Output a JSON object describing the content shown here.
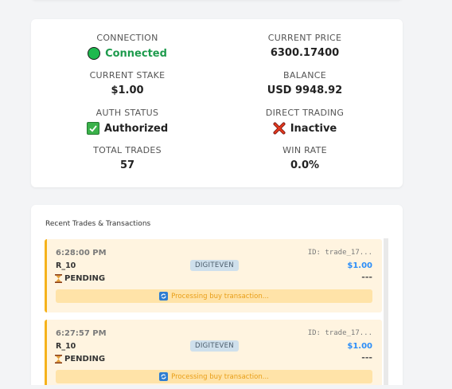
{
  "stats": {
    "connection": {
      "label": "CONNECTION",
      "value": "Connected",
      "icon": "green-circle-icon"
    },
    "current_price": {
      "label": "CURRENT PRICE",
      "value": "6300.17400"
    },
    "current_stake": {
      "label": "CURRENT STAKE",
      "value": "$1.00"
    },
    "balance": {
      "label": "BALANCE",
      "value": "USD 9948.92"
    },
    "auth_status": {
      "label": "AUTH STATUS",
      "value": "Authorized",
      "icon": "check-mark-icon"
    },
    "direct_trading": {
      "label": "DIRECT TRADING",
      "value": "Inactive",
      "icon": "cross-mark-icon"
    },
    "total_trades": {
      "label": "TOTAL TRADES",
      "value": "57"
    },
    "win_rate": {
      "label": "WIN RATE",
      "value": "0.0%"
    }
  },
  "trades_section": {
    "title": "Recent Trades & Transactions",
    "items": [
      {
        "time": "6:28:00 PM",
        "id": "ID: trade_17...",
        "symbol": "R_10",
        "contract": "DIGITEVEN",
        "amount": "$1.00",
        "status": "PENDING",
        "profit": "---",
        "progress": "Processing buy transaction..."
      },
      {
        "time": "6:27:57 PM",
        "id": "ID: trade_17...",
        "symbol": "R_10",
        "contract": "DIGITEVEN",
        "amount": "$1.00",
        "status": "PENDING",
        "profit": "---",
        "progress": "Processing buy transaction..."
      }
    ]
  },
  "colors": {
    "connected": "#1e9b4d",
    "amount": "#2c8ef8",
    "pending_border": "#f5b21b",
    "pending_bg": "#fff4e0",
    "processing_text": "#e89e17"
  }
}
